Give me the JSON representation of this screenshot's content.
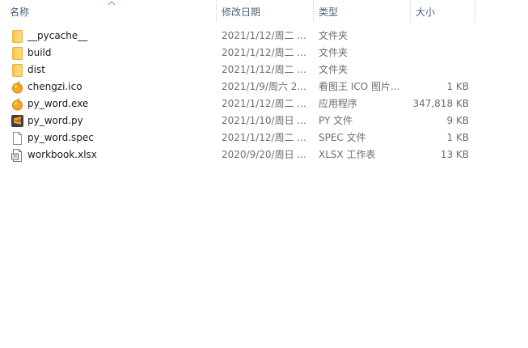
{
  "columns": {
    "name": "名称",
    "date": "修改日期",
    "type": "类型",
    "size": "大小"
  },
  "files": [
    {
      "name": "__pycache__",
      "date": "2021/1/12/周二 ...",
      "type": "文件夹",
      "size": "",
      "icon": "folder-icon"
    },
    {
      "name": "build",
      "date": "2021/1/12/周二 ...",
      "type": "文件夹",
      "size": "",
      "icon": "folder-icon"
    },
    {
      "name": "dist",
      "date": "2021/1/12/周二 ...",
      "type": "文件夹",
      "size": "",
      "icon": "folder-icon"
    },
    {
      "name": "chengzi.ico",
      "date": "2021/1/9/周六 2...",
      "type": "看图王 ICO 图片...",
      "size": "1 KB",
      "icon": "orange-ico-icon"
    },
    {
      "name": "py_word.exe",
      "date": "2021/1/12/周二 ...",
      "type": "应用程序",
      "size": "347,818 KB",
      "icon": "orange-exe-icon"
    },
    {
      "name": "py_word.py",
      "date": "2021/1/10/周日 ...",
      "type": "PY 文件",
      "size": "9 KB",
      "icon": "sublime-text-icon"
    },
    {
      "name": "py_word.spec",
      "date": "2021/1/12/周二 ...",
      "type": "SPEC 文件",
      "size": "1 KB",
      "icon": "blank-file-icon"
    },
    {
      "name": "workbook.xlsx",
      "date": "2020/9/20/周日 ...",
      "type": "XLSX 工作表",
      "size": "13 KB",
      "icon": "xlsx-file-icon"
    }
  ],
  "colors": {
    "header_text": "#4c607a",
    "folder": "#ffd56c",
    "orange": "#f5a623",
    "sublime": "#ff9800"
  }
}
